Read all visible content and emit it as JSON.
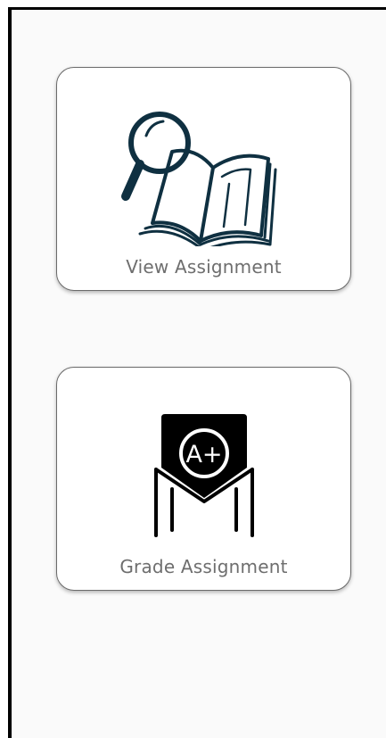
{
  "cards": [
    {
      "label": "View Assignment",
      "icon": "magnifying-glass-book-icon"
    },
    {
      "label": "Grade Assignment",
      "icon": "a-plus-grade-envelope-icon",
      "badge_text": "A+"
    }
  ],
  "colors": {
    "icon_primary": "#0f3041",
    "label_text": "#6e6e6e",
    "card_border": "#6b6b6b",
    "screen_background": "#fafafa"
  }
}
